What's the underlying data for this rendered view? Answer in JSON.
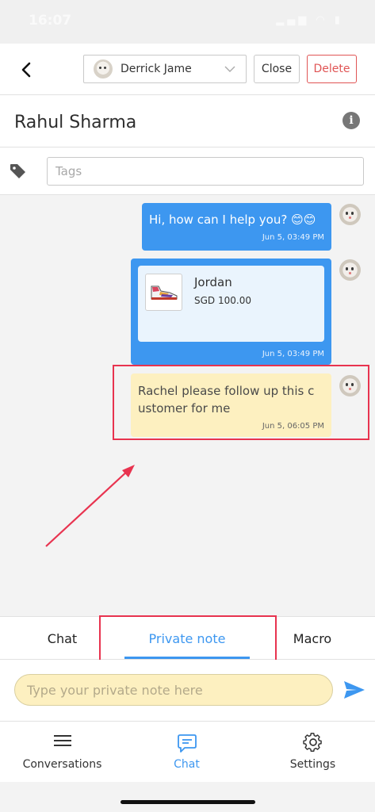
{
  "status_bar": {
    "time": "16:07",
    "icons": "signal wifi battery"
  },
  "top_bar": {
    "agent_name": "Derrick Jame",
    "close_label": "Close",
    "delete_label": "Delete"
  },
  "contact": {
    "name": "Rahul Sharma"
  },
  "tags": {
    "placeholder": "Tags"
  },
  "messages": [
    {
      "type": "text",
      "text": "Hi, how can I help you? 😊😊",
      "time": "Jun 5, 03:49 PM"
    },
    {
      "type": "product",
      "product_name": "Jordan",
      "price": "SGD 100.00",
      "time": "Jun 5, 03:49 PM"
    },
    {
      "type": "private_note",
      "text_line1": "Rachel please follow up this c",
      "text_line2": "ustomer for me",
      "time": "Jun 5, 06:05 PM"
    }
  ],
  "input_tabs": [
    {
      "label": "Chat",
      "active": false
    },
    {
      "label": "Private note",
      "active": true
    },
    {
      "label": "Macro",
      "active": false
    }
  ],
  "composer": {
    "placeholder": "Type your private note here"
  },
  "bottom_nav": [
    {
      "label": "Conversations",
      "icon": "menu-icon",
      "active": false
    },
    {
      "label": "Chat",
      "icon": "chat-icon",
      "active": true
    },
    {
      "label": "Settings",
      "icon": "gear-icon",
      "active": false
    }
  ],
  "colors": {
    "accent": "#3d97f0",
    "note_background": "#fdf0c0",
    "annotation_red": "#e8334f",
    "delete_red": "#e05555"
  }
}
